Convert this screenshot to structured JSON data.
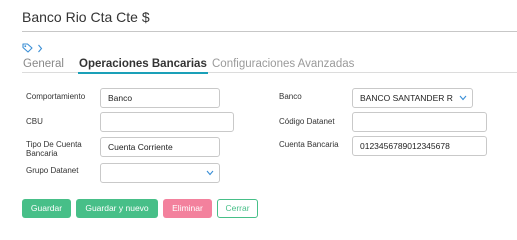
{
  "page": {
    "title": "Banco Rio Cta Cte $"
  },
  "tabs": [
    {
      "label": "General"
    },
    {
      "label": "Operaciones Bancarias"
    },
    {
      "label": "Configuraciones Avanzadas"
    }
  ],
  "form": {
    "comportamiento": {
      "label": "Comportamiento",
      "value": "Banco"
    },
    "cbu": {
      "label": "CBU",
      "value": ""
    },
    "tipo_cuenta": {
      "label": "Tipo De Cuenta Bancaria",
      "value": "Cuenta Corriente"
    },
    "grupo_datanet": {
      "label": "Grupo Datanet",
      "value": ""
    },
    "banco": {
      "label": "Banco",
      "value": "BANCO SANTANDER R"
    },
    "codigo_datanet": {
      "label": "Código Datanet",
      "value": ""
    },
    "cuenta_bancaria": {
      "label": "Cuenta Bancaria",
      "value": "0123456789012345678"
    }
  },
  "buttons": {
    "save": "Guardar",
    "save_new": "Guardar y nuevo",
    "delete": "Eliminar",
    "close": "Cerrar"
  },
  "colors": {
    "accent": "#1aa0b8",
    "primary_button": "#47bf88",
    "danger_button": "#f3819d",
    "link": "#3b8fd6"
  },
  "icons": {
    "breadcrumb_tag": "tag-icon",
    "breadcrumb_chevron": "chevron-right-icon",
    "select_chevron": "chevron-down-icon"
  }
}
